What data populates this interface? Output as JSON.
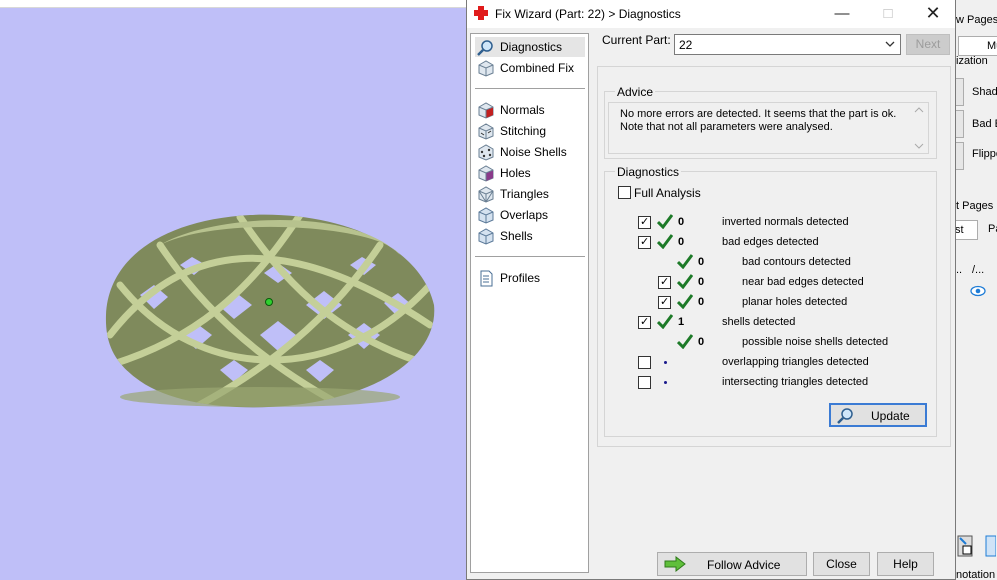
{
  "window": {
    "title": "Fix Wizard (Part: 22) > Diagnostics"
  },
  "nav": {
    "items": [
      {
        "label": "Diagnostics",
        "icon": "magnifier-icon"
      },
      {
        "label": "Combined Fix",
        "icon": "combined-fix-cube-icon"
      },
      {
        "label": "Normals",
        "icon": "normals-cube-icon"
      },
      {
        "label": "Stitching",
        "icon": "stitching-cube-icon"
      },
      {
        "label": "Noise Shells",
        "icon": "noise-shells-cube-icon"
      },
      {
        "label": "Holes",
        "icon": "holes-cube-icon"
      },
      {
        "label": "Triangles",
        "icon": "triangles-cube-icon"
      },
      {
        "label": "Overlaps",
        "icon": "overlaps-cube-icon"
      },
      {
        "label": "Shells",
        "icon": "shells-cube-icon"
      },
      {
        "label": "Profiles",
        "icon": "profiles-document-icon"
      }
    ]
  },
  "part": {
    "label": "Current Part:",
    "value": "22",
    "next_label": "Next"
  },
  "advice": {
    "title": "Advice",
    "line1": "No more errors are detected. It seems that the part is ok.",
    "line2": "Note that not all parameters were analysed."
  },
  "diagnostics": {
    "title": "Diagnostics",
    "full_analysis_label": "Full Analysis",
    "rows": [
      {
        "checkbox": true,
        "checked": true,
        "status": "ok",
        "count": "0",
        "text": "inverted normals detected"
      },
      {
        "checkbox": true,
        "checked": true,
        "status": "ok",
        "count": "0",
        "text": "bad edges detected"
      },
      {
        "checkbox": false,
        "checked": false,
        "status": "ok",
        "count": "0",
        "text": "bad contours detected"
      },
      {
        "checkbox": true,
        "checked": true,
        "status": "ok",
        "count": "0",
        "text": "near bad edges detected"
      },
      {
        "checkbox": true,
        "checked": true,
        "status": "ok",
        "count": "0",
        "text": "planar holes detected"
      },
      {
        "checkbox": true,
        "checked": true,
        "status": "ok",
        "count": "1",
        "text": "shells detected"
      },
      {
        "checkbox": false,
        "checked": false,
        "status": "ok",
        "count": "0",
        "text": "possible noise shells detected"
      },
      {
        "checkbox": true,
        "checked": false,
        "status": "none",
        "count": "",
        "text": "overlapping triangles detected"
      },
      {
        "checkbox": true,
        "checked": false,
        "status": "none",
        "count": "",
        "text": "intersecting triangles detected"
      }
    ],
    "update_label": "Update"
  },
  "footer": {
    "follow_advice": "Follow Advice",
    "close": "Close",
    "help": "Help"
  },
  "background_panel": {
    "pages": "w Pages",
    "tab": "Mu",
    "ization": "ization",
    "shade": "Shad",
    "bad": "Bad E",
    "flipped": "Flippe",
    "t_pages": "t Pages",
    "st": "st",
    "pa": "Pa",
    "dots": "..",
    "slash": "/...",
    "annotation": "notation"
  },
  "colors": {
    "viewport": "#bfbff8",
    "model": "#a9b682",
    "check_green": "#1d7a28",
    "dialog_bg": "#f0f0f0"
  }
}
